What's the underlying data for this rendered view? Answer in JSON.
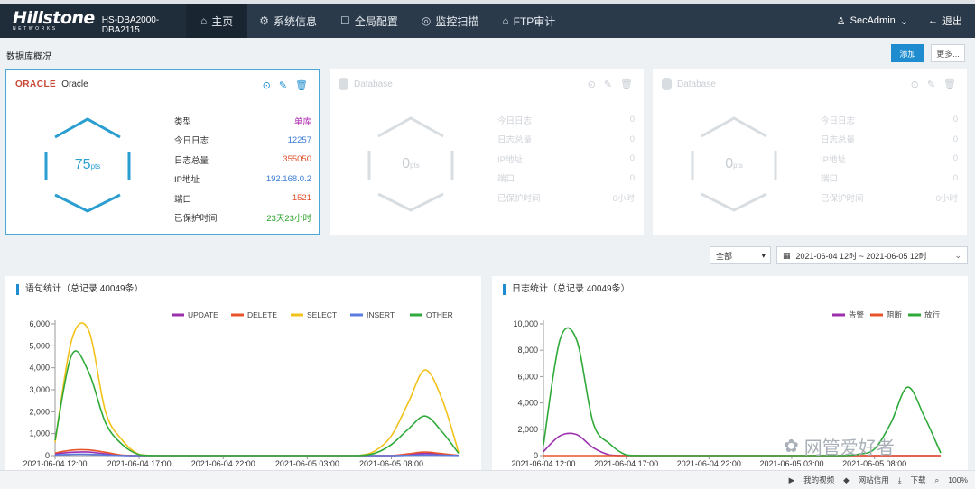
{
  "nav": {
    "brand": "Hillstone",
    "brand_sub": "NETWORKS",
    "model": "HS-DBA2000-DBA2115",
    "items": [
      {
        "icon": "home-icon",
        "glyph": "⌂",
        "label": "主页"
      },
      {
        "icon": "settings-icon",
        "glyph": "⚙",
        "label": "系统信息"
      },
      {
        "icon": "config-icon",
        "glyph": "☐",
        "label": "全局配置"
      },
      {
        "icon": "scan-icon",
        "glyph": "◎",
        "label": "监控扫描"
      },
      {
        "icon": "ftp-icon",
        "glyph": "⌂",
        "label": "FTP审计"
      }
    ],
    "user": "SecAdmin",
    "logout": "退出"
  },
  "overview": {
    "title": "数据库概况",
    "add_button": "添加",
    "more_button": "更多..."
  },
  "cards": [
    {
      "logo": "ORACLE",
      "name": "Oracle",
      "score": "75",
      "score_unit": "pts",
      "rows": [
        {
          "label": "类型",
          "value": "单库",
          "color": "#b02ab0"
        },
        {
          "label": "今日日志",
          "value": "12257",
          "color": "#3a7bd5"
        },
        {
          "label": "日志总量",
          "value": "355050",
          "color": "#e0502a"
        },
        {
          "label": "IP地址",
          "value": "192.168.0.2",
          "color": "#3a7bd5"
        },
        {
          "label": "端口",
          "value": "1521",
          "color": "#e0502a"
        },
        {
          "label": "已保护时间",
          "value": "23天23小时",
          "color": "#2aa02a"
        }
      ]
    },
    {
      "name": "Database",
      "score": "0",
      "score_unit": "pts",
      "rows": [
        {
          "label": "今日日志",
          "value": "0"
        },
        {
          "label": "日志总量",
          "value": "0"
        },
        {
          "label": "IP地址",
          "value": "0"
        },
        {
          "label": "端口",
          "value": "0"
        },
        {
          "label": "已保护时间",
          "value": "0小时"
        }
      ]
    },
    {
      "name": "Database",
      "score": "0",
      "score_unit": "pts",
      "rows": [
        {
          "label": "今日日志",
          "value": "0"
        },
        {
          "label": "日志总量",
          "value": "0"
        },
        {
          "label": "IP地址",
          "value": "0"
        },
        {
          "label": "端口",
          "value": "0"
        },
        {
          "label": "已保护时间",
          "value": "0小时"
        }
      ]
    }
  ],
  "filters": {
    "scope": "全部",
    "date_range": "2021-06-04 12时 ~ 2021-06-05 12时"
  },
  "colors": {
    "accent": "#1f8ccf",
    "UPDATE": "#9b2fae",
    "DELETE": "#e8542a",
    "SELECT": "#f2c21b",
    "INSERT": "#5b7be0",
    "OTHER": "#2faa3a",
    "告警": "#9b2fae",
    "阻断": "#e8542a",
    "放行": "#2faa3a"
  },
  "chart_data": [
    {
      "type": "line",
      "title": "语句统计（总记录 40049条）",
      "x": [
        0,
        1,
        2,
        3,
        4,
        5,
        6,
        7,
        8,
        9,
        10,
        11,
        12,
        13,
        14,
        15,
        16,
        17,
        18,
        19,
        20,
        21,
        22,
        23,
        24
      ],
      "xticks": [
        "2021-06-04 12:00",
        "2021-06-04 17:00",
        "2021-06-04 22:00",
        "2021-06-05 03:00",
        "2021-06-05 08:00"
      ],
      "xtick_at": [
        0,
        5,
        10,
        15,
        20
      ],
      "ylim": [
        0,
        6000
      ],
      "yticks": [
        "0",
        "1,000",
        "2,000",
        "3,000",
        "4,000",
        "5,000",
        "6,000"
      ],
      "series": [
        {
          "name": "UPDATE",
          "values": [
            80,
            150,
            160,
            80,
            10,
            0,
            0,
            0,
            0,
            0,
            0,
            0,
            0,
            0,
            0,
            0,
            0,
            0,
            0,
            0,
            0,
            40,
            100,
            60,
            10
          ]
        },
        {
          "name": "DELETE",
          "values": [
            120,
            250,
            260,
            150,
            20,
            0,
            0,
            0,
            0,
            0,
            0,
            0,
            0,
            0,
            0,
            0,
            0,
            0,
            0,
            0,
            0,
            80,
            160,
            90,
            10
          ]
        },
        {
          "name": "SELECT",
          "values": [
            600,
            5300,
            5700,
            2000,
            700,
            50,
            0,
            0,
            0,
            0,
            0,
            0,
            0,
            0,
            0,
            0,
            0,
            0,
            0,
            200,
            900,
            2400,
            3900,
            2600,
            150
          ]
        },
        {
          "name": "INSERT",
          "values": [
            30,
            60,
            60,
            30,
            5,
            0,
            0,
            0,
            0,
            0,
            0,
            0,
            0,
            0,
            0,
            0,
            0,
            0,
            0,
            0,
            0,
            15,
            30,
            20,
            5
          ]
        },
        {
          "name": "OTHER",
          "values": [
            700,
            4600,
            3800,
            1500,
            500,
            40,
            0,
            0,
            0,
            0,
            0,
            0,
            0,
            0,
            0,
            0,
            0,
            0,
            0,
            100,
            500,
            1200,
            1800,
            1100,
            100
          ]
        }
      ],
      "legend": "top-right"
    },
    {
      "type": "line",
      "title": "日志统计（总记录 40049条）",
      "x": [
        0,
        1,
        2,
        3,
        4,
        5,
        6,
        7,
        8,
        9,
        10,
        11,
        12,
        13,
        14,
        15,
        16,
        17,
        18,
        19,
        20,
        21,
        22,
        23,
        24
      ],
      "xticks": [
        "2021-06-04 12:00",
        "2021-06-04 17:00",
        "2021-06-04 22:00",
        "2021-06-05 03:00",
        "2021-06-05 08:00"
      ],
      "xtick_at": [
        0,
        5,
        10,
        15,
        20
      ],
      "ylim": [
        0,
        10000
      ],
      "yticks": [
        "0",
        "2,000",
        "4,000",
        "6,000",
        "8,000",
        "10,000"
      ],
      "series": [
        {
          "name": "告警",
          "values": [
            300,
            1500,
            1600,
            600,
            50,
            0,
            0,
            0,
            0,
            0,
            0,
            0,
            0,
            0,
            0,
            0,
            0,
            0,
            0,
            0,
            0,
            0,
            0,
            0,
            0
          ]
        },
        {
          "name": "阻断",
          "values": [
            0,
            0,
            0,
            0,
            0,
            0,
            0,
            0,
            0,
            0,
            0,
            0,
            0,
            0,
            0,
            0,
            0,
            0,
            0,
            0,
            0,
            0,
            0,
            0,
            0
          ]
        },
        {
          "name": "放行",
          "values": [
            800,
            8800,
            8800,
            2500,
            900,
            50,
            0,
            0,
            0,
            0,
            0,
            0,
            0,
            0,
            0,
            0,
            0,
            0,
            0,
            100,
            500,
            2500,
            5200,
            3000,
            200
          ]
        }
      ],
      "legend": "top-right"
    }
  ],
  "statusbar": {
    "items": [
      "我的视频",
      "网站信用",
      "下载",
      "100%"
    ]
  },
  "watermark": "网管爱好者"
}
